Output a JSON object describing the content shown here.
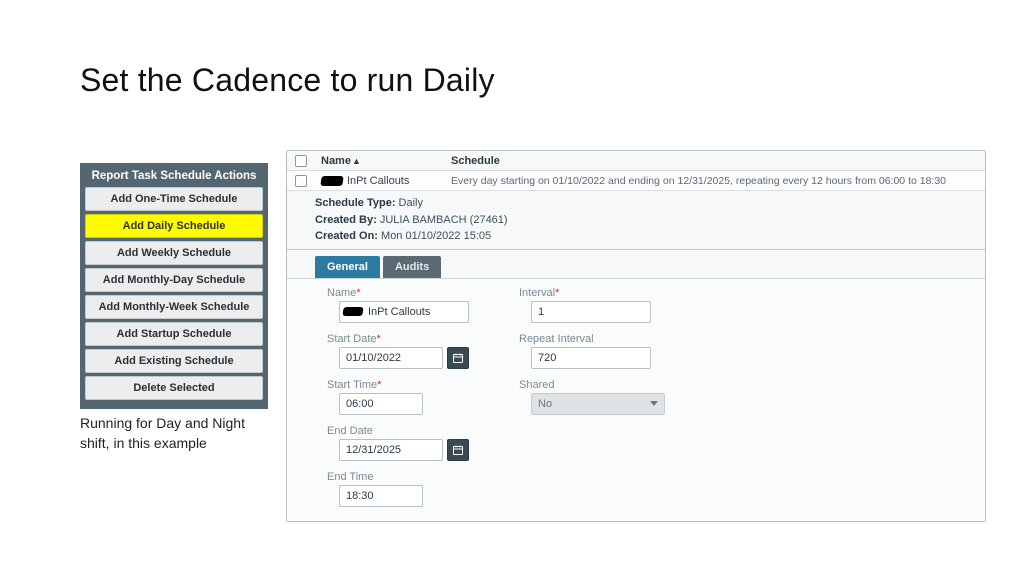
{
  "title": "Set the Cadence to run Daily",
  "caption": "Running for Day and Night shift, in this example",
  "sidebar": {
    "title": "Report Task Schedule Actions",
    "items": [
      {
        "label": "Add One-Time Schedule"
      },
      {
        "label": "Add Daily Schedule"
      },
      {
        "label": "Add Weekly Schedule"
      },
      {
        "label": "Add Monthly-Day Schedule"
      },
      {
        "label": "Add Monthly-Week Schedule"
      },
      {
        "label": "Add Startup Schedule"
      },
      {
        "label": "Add Existing Schedule"
      },
      {
        "label": "Delete Selected"
      }
    ]
  },
  "table": {
    "header_name": "Name",
    "header_schedule": "Schedule",
    "row": {
      "name": "InPt Callouts",
      "schedule": "Every day starting on 01/10/2022 and ending on 12/31/2025, repeating every 12 hours from 06:00 to 18:30"
    }
  },
  "drawer": {
    "type_k": "Schedule Type:",
    "type_v": "Daily",
    "by_k": "Created By:",
    "by_v": "JULIA BAMBACH (27461)",
    "on_k": "Created On:",
    "on_v": "Mon 01/10/2022 15:05"
  },
  "tabs": {
    "general": "General",
    "audits": "Audits"
  },
  "form": {
    "name_label": "Name",
    "name_value": "InPt Callouts",
    "startdate_label": "Start Date",
    "startdate_value": "01/10/2022",
    "starttime_label": "Start Time",
    "starttime_value": "06:00",
    "enddate_label": "End Date",
    "enddate_value": "12/31/2025",
    "endtime_label": "End Time",
    "endtime_value": "18:30",
    "interval_label": "Interval",
    "interval_value": "1",
    "repeat_label": "Repeat Interval",
    "repeat_value": "720",
    "shared_label": "Shared",
    "shared_value": "No"
  }
}
